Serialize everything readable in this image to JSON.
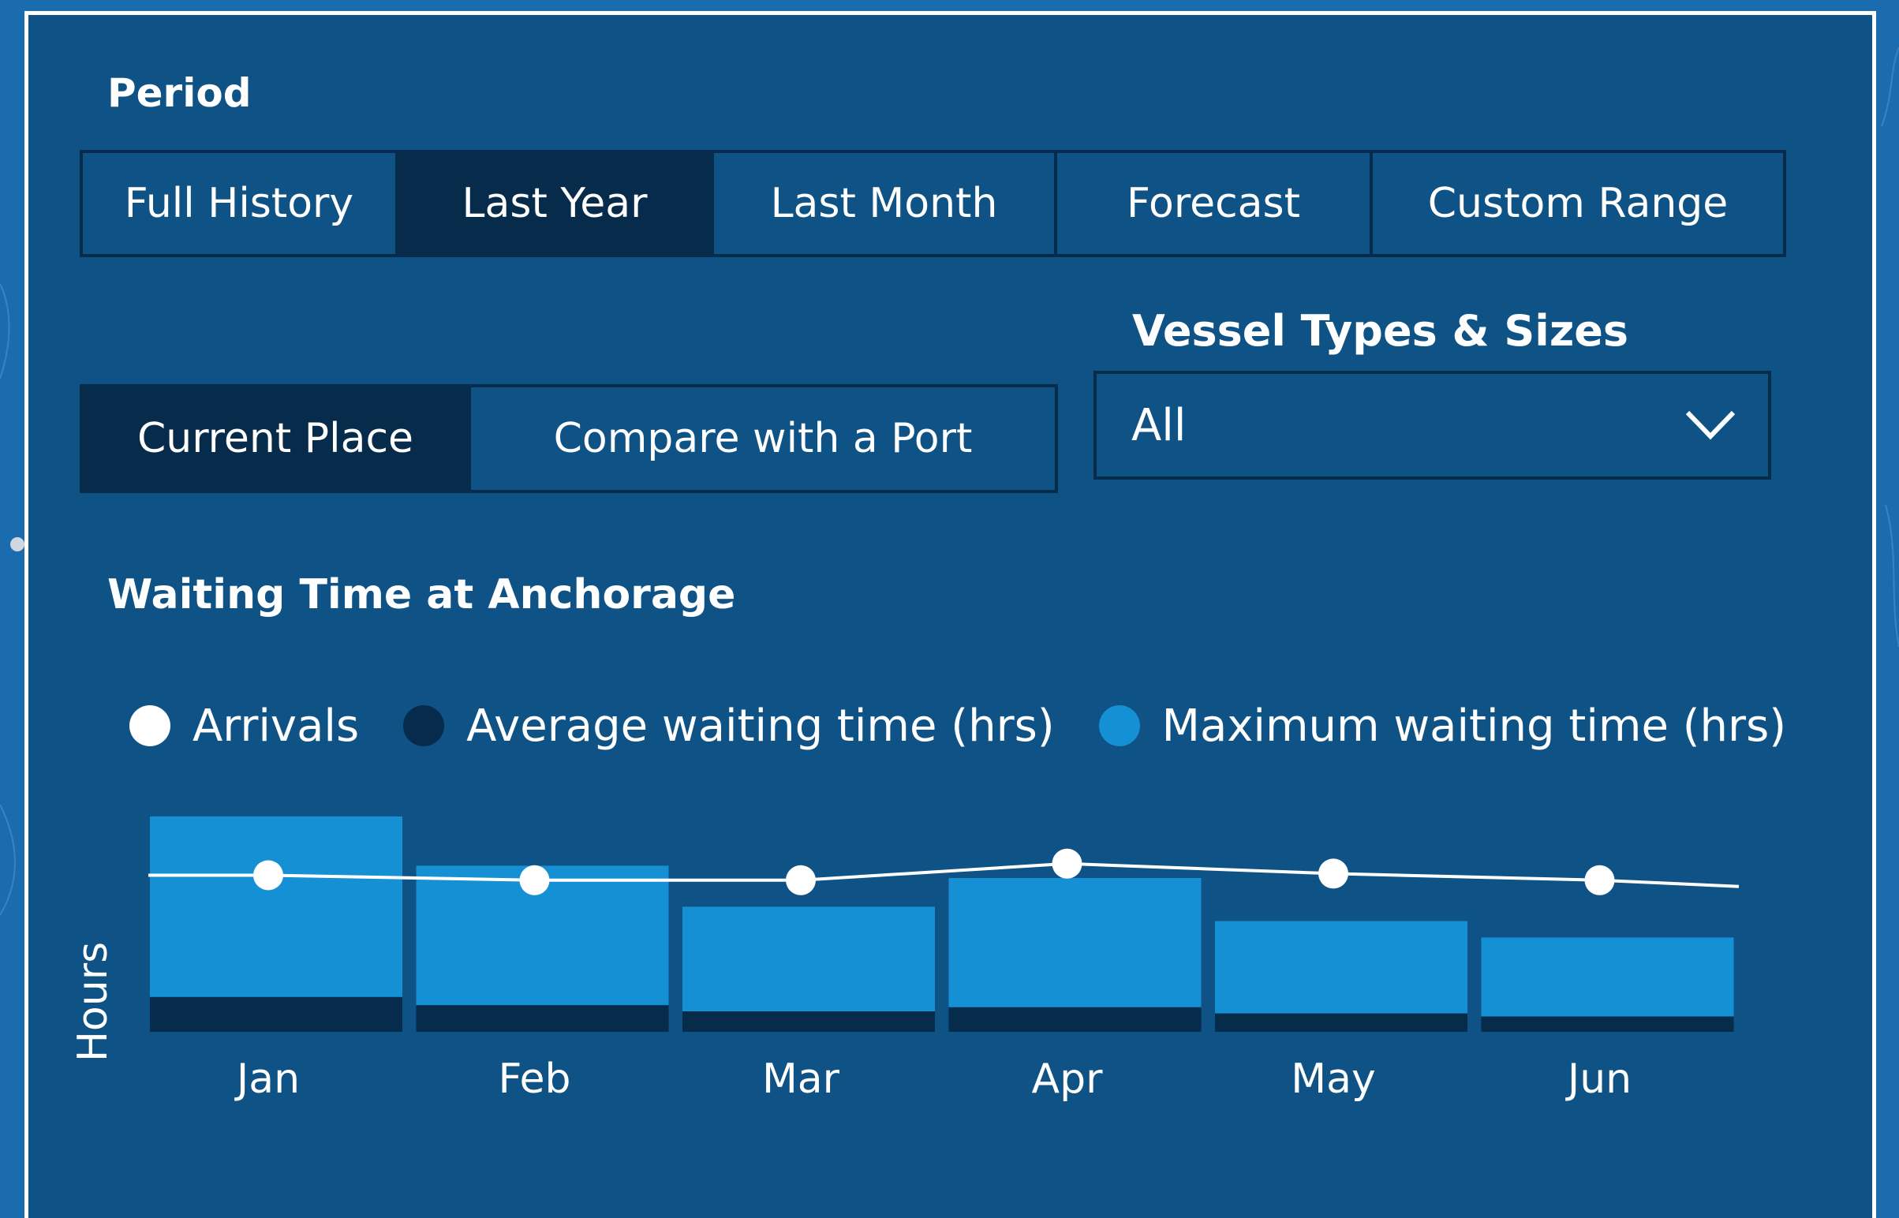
{
  "colors": {
    "panel": "#0f5285",
    "dark": "#062b4b",
    "accent": "#1590d4",
    "white": "#ffffff"
  },
  "period": {
    "heading": "Period",
    "options": [
      "Full History",
      "Last Year",
      "Last Month",
      "Forecast",
      "Custom Range"
    ],
    "selected": "Last Year"
  },
  "place": {
    "options": [
      "Current Place",
      "Compare with a Port"
    ],
    "selected": "Current Place"
  },
  "vessel": {
    "heading": "Vessel Types & Sizes",
    "value": "All",
    "icon": "chevron-down-icon"
  },
  "chart_title": "Waiting Time at Anchorage",
  "chart_data": {
    "type": "bar",
    "categories": [
      "Jan",
      "Feb",
      "Mar",
      "Apr",
      "May",
      "Jun"
    ],
    "series": [
      {
        "name": "Arrivals",
        "type": "line",
        "color": "#ffffff",
        "values": [
          55,
          52,
          52,
          62,
          56,
          52
        ]
      },
      {
        "name": "Average waiting time (hrs)",
        "type": "bar",
        "color": "#062b4b",
        "values": [
          17,
          13,
          10,
          12,
          9,
          7.5
        ]
      },
      {
        "name": "Maximum waiting time (hrs)",
        "type": "bar",
        "color": "#1590d4",
        "values": [
          105,
          81,
          61,
          75,
          54,
          46
        ]
      }
    ],
    "ylabel": "Hours",
    "xlabel": "",
    "ylim": [
      0,
      105
    ],
    "grid": false,
    "legend": "top-left"
  }
}
